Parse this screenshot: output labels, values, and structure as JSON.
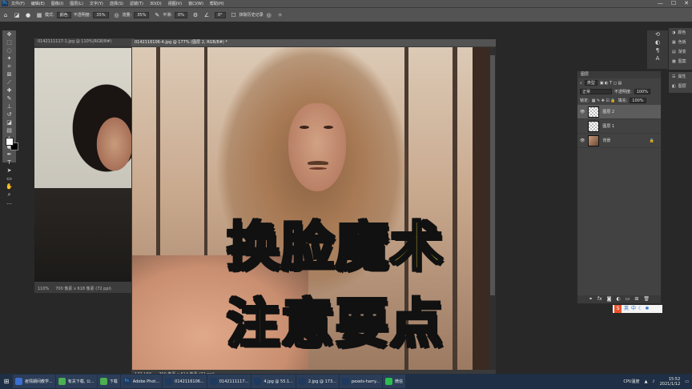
{
  "menubar": {
    "logo": "Ps",
    "items": [
      "文件(F)",
      "编辑(E)",
      "图像(I)",
      "图层(L)",
      "文字(Y)",
      "选择(S)",
      "滤镜(T)",
      "3D(D)",
      "视图(V)",
      "窗口(W)",
      "帮助(H)"
    ],
    "controls": [
      "—",
      "☐",
      "✕"
    ]
  },
  "options": {
    "mode_label": "模式:",
    "mode_value": "颜色",
    "opacity_label": "不透明度:",
    "opacity_value": "35%",
    "flow_label": "流量:",
    "flow_value": "35%",
    "smooth_label": "平滑:",
    "smooth_value": "0%",
    "angle_value": "0°",
    "history_label": "抹除历史记录"
  },
  "doc1": {
    "tab": "0142111117-1.jpg @ 110%(RGB/8#)",
    "status_zoom": "110%",
    "status_size": "700 像素 x 618 像素 (72 ppi)"
  },
  "doc2": {
    "tab": "0142116106-4.jpg @ 177% (图层 2, RGB/8#) *",
    "status_zoom": "177.16%",
    "status_size": "700 像素 x 614 像素 (72 ppi)",
    "overlay_line1": "换脸魔术",
    "overlay_line2": "注意要点"
  },
  "right_panels": {
    "items": [
      "颜色",
      "色板",
      "渐变",
      "图案"
    ],
    "history_items": [
      "属性",
      "图层"
    ]
  },
  "layers_panel": {
    "title": "图层",
    "filter_label": "类型",
    "blend_mode": "正常",
    "opacity_label": "不透明度:",
    "opacity_value": "100%",
    "lock_label": "锁定:",
    "fill_label": "填充:",
    "fill_value": "100%",
    "layers": [
      {
        "name": "图层 2"
      },
      {
        "name": "图层 1"
      },
      {
        "name": "背景"
      }
    ]
  },
  "ime": {
    "s": "S",
    "items": [
      "英",
      "中"
    ]
  },
  "taskbar": {
    "tasks": [
      {
        "label": "疫情期间教学..."
      },
      {
        "label": "有关下载, 公..."
      },
      {
        "label": "下载"
      },
      {
        "label": "Adobe Phot..."
      },
      {
        "label": "0142116106..."
      },
      {
        "label": "0142111117..."
      },
      {
        "label": "4.jpg @ 55.1..."
      },
      {
        "label": "2.jpg @ 173..."
      },
      {
        "label": "pexels-harry..."
      },
      {
        "label": "微信"
      }
    ],
    "tray_cpu": "CPU温度",
    "time": "15:52",
    "date": "2021/1/12"
  },
  "colors": {
    "accent": "#31a8ff",
    "overlay_text": "#f7e13a",
    "taskbar": "#1f2f45"
  }
}
